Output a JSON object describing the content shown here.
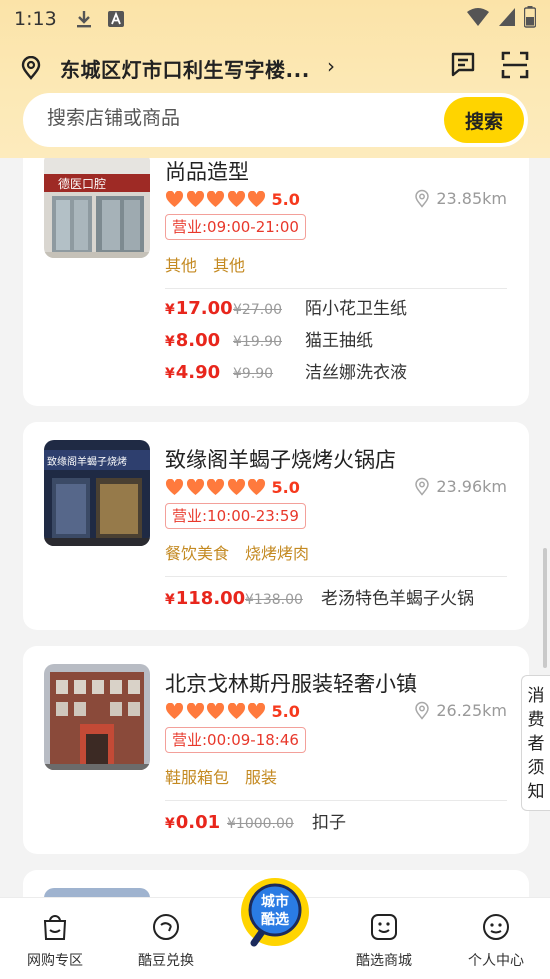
{
  "status_bar": {
    "time": "1:13"
  },
  "header": {
    "location": "东城区灯市口利生写字楼...",
    "chevron": "›",
    "message_icon": "message-icon",
    "scan_icon": "scan-icon"
  },
  "search": {
    "placeholder": "搜索店铺或商品",
    "button": "搜索"
  },
  "stores": [
    {
      "name": "尚品造型",
      "rating": "5.0",
      "hearts": 5,
      "distance": "23.85km",
      "hours": "营业:09:00-21:00",
      "categories": [
        "其他",
        "其他"
      ],
      "deals": [
        {
          "price": "17.00",
          "original": "27.00",
          "name": "陌小花卫生纸"
        },
        {
          "price": "8.00",
          "original": "19.90",
          "name": "猫王抽纸"
        },
        {
          "price": "4.90",
          "original": "9.90",
          "name": "洁丝娜洗衣液"
        }
      ]
    },
    {
      "name": "致缘阁羊蝎子烧烤火锅店",
      "rating": "5.0",
      "hearts": 5,
      "distance": "23.96km",
      "hours": "营业:10:00-23:59",
      "categories": [
        "餐饮美食",
        "烧烤烤肉"
      ],
      "deals": [
        {
          "price": "118.00",
          "original": "138.00",
          "name": "老汤特色羊蝎子火锅"
        }
      ]
    },
    {
      "name": "北京戈林斯丹服装轻奢小镇",
      "rating": "5.0",
      "hearts": 5,
      "distance": "26.25km",
      "hours": "营业:00:09-18:46",
      "categories": [
        "鞋服箱包",
        "服装"
      ],
      "deals": [
        {
          "price": "0.01",
          "original": "1000.00",
          "name": "扣子"
        }
      ]
    }
  ],
  "currency": "¥",
  "store_signs": [
    "德医口腔",
    "致缘阁羊蝎子烧烤"
  ],
  "notice_tab": {
    "label": "消费者须知"
  },
  "bottom_nav": {
    "items": [
      {
        "label": "网购专区",
        "icon": "shopping-bag-icon"
      },
      {
        "label": "酷豆兑换",
        "icon": "coin-exchange-icon"
      },
      {
        "label": "酷选商城",
        "icon": "smile-store-icon"
      },
      {
        "label": "个人中心",
        "icon": "profile-icon"
      }
    ],
    "center_logo": "城市酷选"
  },
  "colors": {
    "accent": "#ffd400",
    "price": "#e8261c",
    "category": "#c48a22",
    "header_bg": "#fce9b6"
  }
}
